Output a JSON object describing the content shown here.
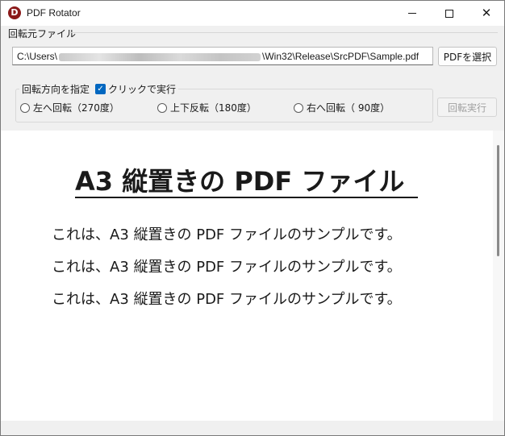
{
  "window": {
    "title": "PDF Rotator",
    "icon_letter": "D",
    "icon_color": "#8b1a1a"
  },
  "source": {
    "group_label": "回転元ファイル",
    "path_prefix": "C:\\Users\\",
    "path_suffix": "\\Win32\\Release\\SrcPDF\\Sample.pdf",
    "select_button": "PDFを選択"
  },
  "direction": {
    "group_label": "回転方向を指定",
    "click_to_run_label": "クリックで実行",
    "click_to_run_checked": true,
    "options": [
      {
        "label": "左へ回転（270度）",
        "selected": false
      },
      {
        "label": "上下反転（180度）",
        "selected": false
      },
      {
        "label": "右へ回転（ 90度）",
        "selected": false
      }
    ],
    "rotate_button": "回転実行",
    "rotate_button_enabled": false
  },
  "preview": {
    "heading": "A3 縦置きの PDF ファイル",
    "lines": [
      "これは、A3 縦置きの PDF ファイルのサンプルです。",
      "これは、A3 縦置きの PDF ファイルのサンプルです。",
      "これは、A3 縦置きの PDF ファイルのサンプルです。"
    ]
  }
}
